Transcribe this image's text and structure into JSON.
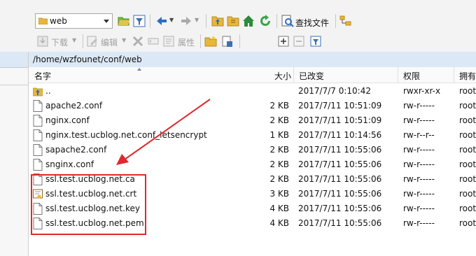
{
  "toolbar": {
    "location_combo": "web",
    "search_files_label": "查找文件",
    "download_label": "下载",
    "edit_label": "编辑",
    "properties_label": "属性"
  },
  "path": "/home/wzfounet/conf/web",
  "columns": {
    "name": "名字",
    "size": "大小",
    "modified": "已改变",
    "permissions": "权限",
    "owner": "拥有"
  },
  "files": [
    {
      "name": "..",
      "size": "",
      "modified": "2017/7/7 0:10:42",
      "permissions": "rwxr-xr-x",
      "owner": "root",
      "icon": "parent-folder-icon"
    },
    {
      "name": "apache2.conf",
      "size": "2 KB",
      "modified": "2017/7/11 10:51:09",
      "permissions": "rw-r-----",
      "owner": "root",
      "icon": "file-icon"
    },
    {
      "name": "nginx.conf",
      "size": "2 KB",
      "modified": "2017/7/11 10:51:09",
      "permissions": "rw-r-----",
      "owner": "root",
      "icon": "file-icon"
    },
    {
      "name": "nginx.test.ucblog.net.conf_letsencrypt",
      "size": "1 KB",
      "modified": "2017/7/11 10:14:56",
      "permissions": "rw-r--r--",
      "owner": "root",
      "icon": "file-icon"
    },
    {
      "name": "sapache2.conf",
      "size": "2 KB",
      "modified": "2017/7/11 10:55:06",
      "permissions": "rw-r-----",
      "owner": "root",
      "icon": "file-icon"
    },
    {
      "name": "snginx.conf",
      "size": "2 KB",
      "modified": "2017/7/11 10:55:06",
      "permissions": "rw-r-----",
      "owner": "root",
      "icon": "file-icon"
    },
    {
      "name": "ssl.test.ucblog.net.ca",
      "size": "2 KB",
      "modified": "2017/7/11 10:55:06",
      "permissions": "rw-r-----",
      "owner": "root",
      "icon": "file-icon"
    },
    {
      "name": "ssl.test.ucblog.net.crt",
      "size": "3 KB",
      "modified": "2017/7/11 10:55:06",
      "permissions": "rw-r-----",
      "owner": "root",
      "icon": "certificate-icon"
    },
    {
      "name": "ssl.test.ucblog.net.key",
      "size": "4 KB",
      "modified": "2017/7/11 10:55:06",
      "permissions": "rw-r-----",
      "owner": "root",
      "icon": "file-icon"
    },
    {
      "name": "ssl.test.ucblog.net.pem",
      "size": "4 KB",
      "modified": "2017/7/11 10:55:06",
      "permissions": "rw-r-----",
      "owner": "root",
      "icon": "file-icon"
    }
  ],
  "colors": {
    "annotation": "#e0282e",
    "header_bg": "#dce8f5"
  }
}
